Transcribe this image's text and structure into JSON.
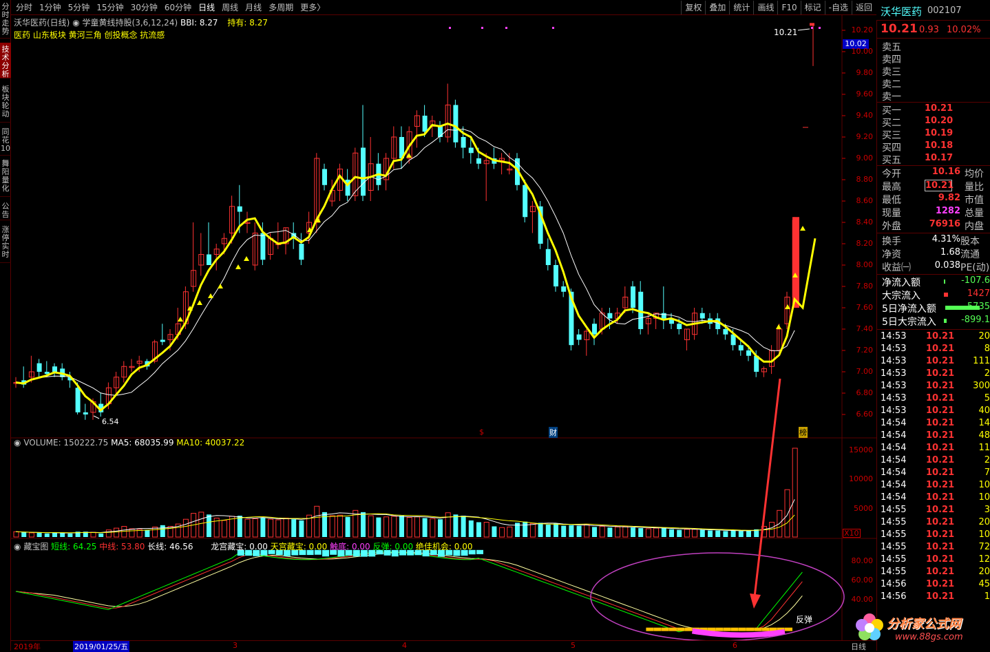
{
  "toolbar": {
    "periods": [
      "分时",
      "1分钟",
      "5分钟",
      "15分钟",
      "30分钟",
      "60分钟",
      "日线",
      "周线",
      "月线",
      "多周期",
      "更多〉"
    ],
    "active_period": "日线",
    "right_buttons": [
      "复权",
      "叠加",
      "统计",
      "画线",
      "F10",
      "标记",
      "-自选",
      "返回"
    ]
  },
  "left_tabs": [
    "分时走势",
    "技术分析",
    "板块轮动",
    "同花10",
    "舞阳量化",
    "公告",
    "涨停实时"
  ],
  "chart": {
    "title": "沃华医药(日线)",
    "indicator_name": "学童黄线持股(3,6,12,24)",
    "bbi": "BBI: 8.27",
    "hold": "持有: 8.27",
    "concepts": "医药 山东板块 黄河三角 创投概念 抗流感",
    "high_label": "10.21",
    "low_label": "6.54",
    "price_axis": [
      "10.20",
      "10.00",
      "9.80",
      "9.60",
      "9.40",
      "9.20",
      "9.00",
      "8.80",
      "8.60",
      "8.40",
      "8.20",
      "8.00",
      "7.80",
      "7.60",
      "7.40",
      "7.20",
      "7.00",
      "6.80",
      "6.60"
    ],
    "current_price_tag": "10.02",
    "markers": {
      "s": "$",
      "cai": "财",
      "bang": "榜"
    }
  },
  "volume": {
    "label": "VOLUME: 150222.75",
    "ma5": "MA5: 68035.99",
    "ma10": "MA10: 40037.22",
    "axis": [
      "15000",
      "10000",
      "5000"
    ],
    "scale": "X10"
  },
  "cangbao": {
    "name": "藏宝图",
    "short": "短线: 64.25",
    "mid": "中线: 53.80",
    "long": "长线: 46.56",
    "longgong": "龙宫藏宝: 0.00",
    "tiangong": "天宫藏宝: 0.00",
    "chudi": "触底: 0.00",
    "fantan": "反弹: 0.00",
    "jiajia": "绝佳机会: 0.00",
    "axis": [
      "80.00",
      "60.00",
      "40.00"
    ],
    "fantan_label": "反弹"
  },
  "dates": {
    "year": "2019年",
    "cursor_date": "2019/01/25/五",
    "months": [
      "3",
      "4",
      "5",
      "6"
    ],
    "corner": "日线"
  },
  "stock": {
    "name": "沃华医药",
    "code": "002107",
    "price": "10.21",
    "change": "0.93",
    "pct": "10.02%"
  },
  "sell": [
    {
      "label": "卖五",
      "price": "",
      "vol": ""
    },
    {
      "label": "卖四",
      "price": "",
      "vol": ""
    },
    {
      "label": "卖三",
      "price": "",
      "vol": ""
    },
    {
      "label": "卖二",
      "price": "",
      "vol": ""
    },
    {
      "label": "卖一",
      "price": "",
      "vol": ""
    }
  ],
  "buy": [
    {
      "label": "买一",
      "price": "10.21"
    },
    {
      "label": "买二",
      "price": "10.20"
    },
    {
      "label": "买三",
      "price": "10.19"
    },
    {
      "label": "买四",
      "price": "10.18"
    },
    {
      "label": "买五",
      "price": "10.17"
    }
  ],
  "stats": [
    {
      "k": "今开",
      "v": "10.16",
      "k2": "均价"
    },
    {
      "k": "最高",
      "v": "10.21",
      "k2": "量比"
    },
    {
      "k": "最低",
      "v": "9.82",
      "k2": "市值"
    },
    {
      "k": "现量",
      "v": "1282",
      "k2": "总量"
    },
    {
      "k": "外盘",
      "v": "76916",
      "k2": "内盘"
    }
  ],
  "stats2": [
    {
      "k": "换手",
      "v": "4.31%",
      "k2": "股本"
    },
    {
      "k": "净资",
      "v": "1.68",
      "k2": "流通"
    },
    {
      "k": "收益㈠",
      "v": "0.038",
      "k2": "PE(动)"
    }
  ],
  "flows": [
    {
      "k": "净流入额",
      "v": "-107.6"
    },
    {
      "k": "大宗流入",
      "v": "1427"
    },
    {
      "k": "5日净流入额",
      "v": "-5735"
    },
    {
      "k": "5日大宗流入",
      "v": "-899.1"
    }
  ],
  "ticks": [
    {
      "t": "14:53",
      "p": "10.21",
      "v": "20"
    },
    {
      "t": "14:53",
      "p": "10.21",
      "v": "8"
    },
    {
      "t": "14:53",
      "p": "10.21",
      "v": "111"
    },
    {
      "t": "14:53",
      "p": "10.21",
      "v": "2"
    },
    {
      "t": "14:53",
      "p": "10.21",
      "v": "300"
    },
    {
      "t": "14:53",
      "p": "10.21",
      "v": "5"
    },
    {
      "t": "14:53",
      "p": "10.21",
      "v": "40"
    },
    {
      "t": "14:54",
      "p": "10.21",
      "v": "14"
    },
    {
      "t": "14:54",
      "p": "10.21",
      "v": "48"
    },
    {
      "t": "14:54",
      "p": "10.21",
      "v": "11"
    },
    {
      "t": "14:54",
      "p": "10.21",
      "v": "2"
    },
    {
      "t": "14:54",
      "p": "10.21",
      "v": "7"
    },
    {
      "t": "14:54",
      "p": "10.21",
      "v": "10"
    },
    {
      "t": "14:54",
      "p": "10.21",
      "v": "10"
    },
    {
      "t": "14:55",
      "p": "10.21",
      "v": "3"
    },
    {
      "t": "14:55",
      "p": "10.21",
      "v": "20"
    },
    {
      "t": "14:55",
      "p": "10.21",
      "v": "10"
    },
    {
      "t": "14:55",
      "p": "10.21",
      "v": "72"
    },
    {
      "t": "14:55",
      "p": "10.21",
      "v": "12"
    },
    {
      "t": "14:55",
      "p": "10.21",
      "v": "20"
    },
    {
      "t": "14:56",
      "p": "10.21",
      "v": "45"
    },
    {
      "t": "14:56",
      "p": "10.21",
      "v": "1"
    }
  ],
  "watermark": {
    "site": "分析家公式网",
    "url": "www.88gs.com"
  },
  "colors": {
    "up": "#ff3232",
    "down": "#54ffff",
    "ma_yellow": "#ffff00",
    "bg": "#000000",
    "grid": "#5a0000"
  }
}
